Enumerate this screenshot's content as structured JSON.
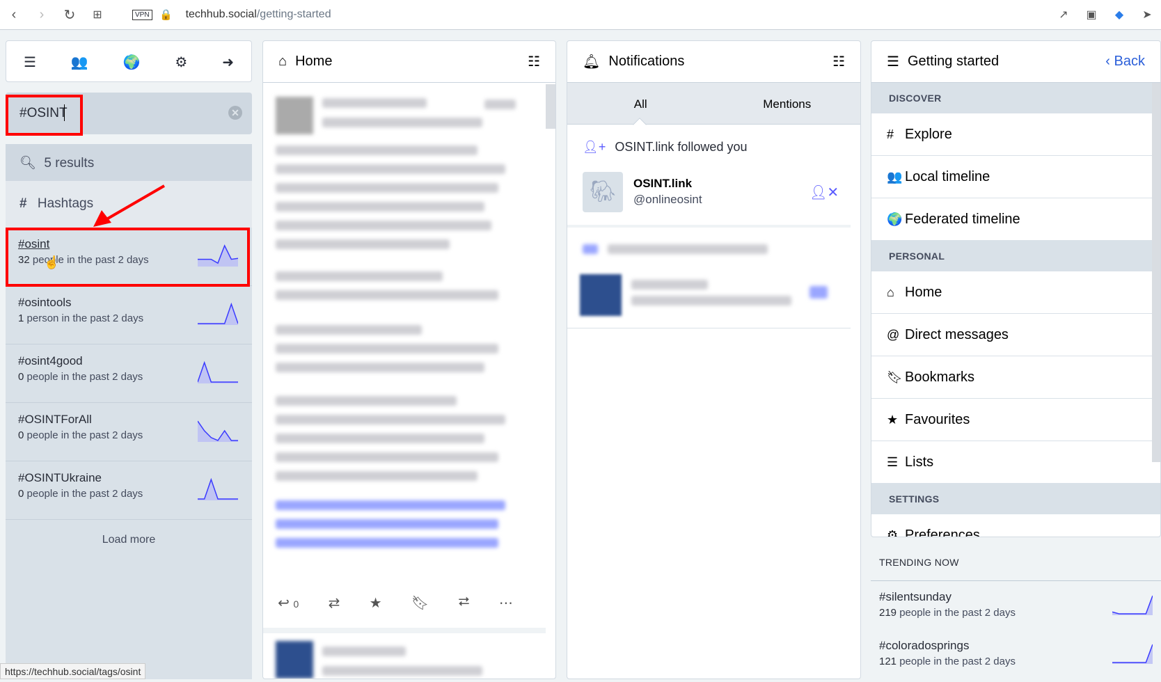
{
  "browser": {
    "url_host": "techhub.social",
    "url_path": "/getting-started",
    "vpn_label": "VPN",
    "status_url": "https://techhub.social/tags/osint"
  },
  "search": {
    "value": "#OSINT",
    "results_label": "5 results",
    "hashtags_label": "Hashtags",
    "load_more": "Load more"
  },
  "hashtags": [
    {
      "name": "#osint",
      "count": "32",
      "suffix": " people in the past 2 days",
      "history": [
        3,
        3,
        3,
        1,
        10,
        3,
        3.5
      ]
    },
    {
      "name": "#osintools",
      "count": "1",
      "suffix": " person in the past 2 days",
      "history": [
        0,
        0,
        0,
        0,
        0,
        1,
        0
      ]
    },
    {
      "name": "#osint4good",
      "count": "0",
      "suffix": " people in the past 2 days",
      "history": [
        0,
        1,
        0,
        0,
        0,
        0,
        0
      ]
    },
    {
      "name": "#OSINTForAll",
      "count": "0",
      "suffix": " people in the past 2 days",
      "history": [
        2,
        1,
        0.3,
        0,
        1,
        0,
        0
      ]
    },
    {
      "name": "#OSINTUkraine",
      "count": "0",
      "suffix": " people in the past 2 days",
      "history": [
        0,
        0,
        1,
        0,
        0,
        0,
        0
      ]
    }
  ],
  "home": {
    "title": "Home",
    "reply_count": "0"
  },
  "notifications": {
    "title": "Notifications",
    "tabs": [
      "All",
      "Mentions"
    ],
    "active_tab": "All",
    "item": {
      "text": "OSINT.link followed you",
      "display_name": "OSINT.link",
      "handle": "@onlineosint"
    }
  },
  "getting_started": {
    "title": "Getting started",
    "back": "Back",
    "discover_label": "DISCOVER",
    "discover": [
      "Explore",
      "Local timeline",
      "Federated timeline"
    ],
    "personal_label": "PERSONAL",
    "personal": [
      "Home",
      "Direct messages",
      "Bookmarks",
      "Favourites",
      "Lists"
    ],
    "settings_label": "SETTINGS",
    "settings": [
      "Preferences"
    ]
  },
  "trending": {
    "label": "TRENDING NOW",
    "items": [
      {
        "name": "#silentsunday",
        "count": "219",
        "suffix": " people in the past 2 days",
        "history": [
          1,
          0,
          0,
          0,
          0,
          0,
          10
        ]
      },
      {
        "name": "#coloradosprings",
        "count": "121",
        "suffix": " people in the past 2 days",
        "history": [
          0,
          0,
          0,
          0,
          0,
          0,
          10
        ]
      }
    ]
  },
  "colors": {
    "accent": "#2b5fd9",
    "sparkline": "#3a3aff",
    "highlight": "#ff0000"
  }
}
